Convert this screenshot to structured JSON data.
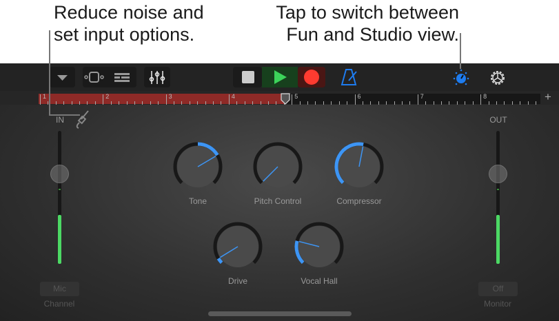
{
  "callouts": {
    "left": "Reduce noise and\nset input options.",
    "right": "Tap to switch between\nFun and Studio view."
  },
  "toolbar": {
    "buttons": [
      "tracks-menu",
      "track-view",
      "tracks-list",
      "mixer",
      "stop",
      "play",
      "record",
      "metronome",
      "fun-studio-toggle",
      "settings"
    ],
    "accent": "#1e7cf0"
  },
  "ruler": {
    "bars": [
      "1",
      "2",
      "3",
      "4",
      "5",
      "6",
      "7",
      "8"
    ],
    "add_label": "+"
  },
  "input": {
    "label": "IN",
    "fader": 0.68,
    "level": 0.37,
    "channel_value": "Mic",
    "channel_label": "Channel"
  },
  "output": {
    "label": "OUT",
    "fader": 0.68,
    "level": 0.37,
    "monitor_value": "Off",
    "monitor_label": "Monitor"
  },
  "knobs": [
    {
      "label": "Tone",
      "value": 0.72,
      "bipolar": true
    },
    {
      "label": "Pitch Control",
      "value": 0.0,
      "bipolar": false
    },
    {
      "label": "Compressor",
      "value": 0.54,
      "bipolar": false
    },
    {
      "label": "Drive",
      "value": 0.05,
      "bipolar": false
    },
    {
      "label": "Vocal Hall",
      "value": 0.22,
      "bipolar": false
    }
  ]
}
